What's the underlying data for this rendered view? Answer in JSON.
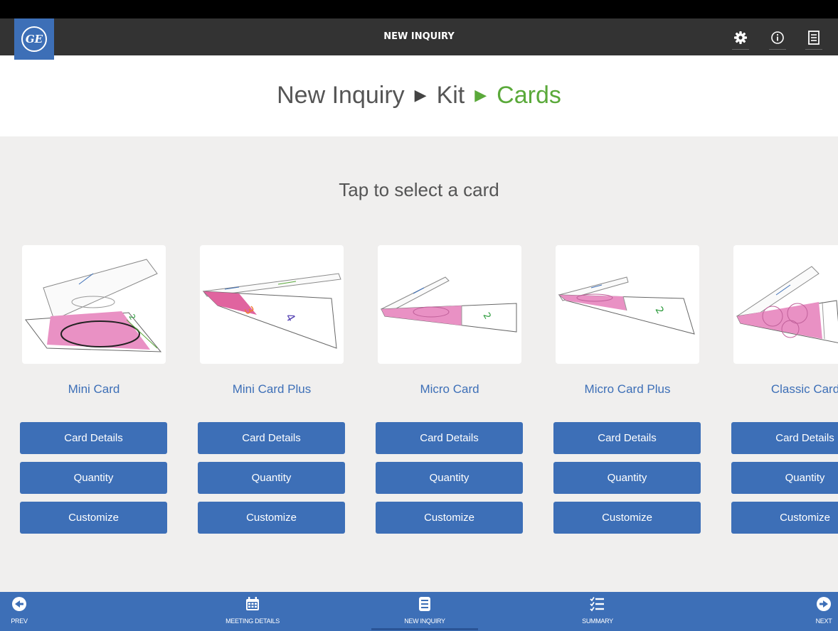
{
  "header": {
    "title": "NEW INQUIRY",
    "logo_text": "GE",
    "icons": [
      "gear-icon",
      "info-icon",
      "list-icon"
    ]
  },
  "breadcrumb": {
    "items": [
      "New Inquiry",
      "Kit",
      "Cards"
    ],
    "separator": "▶",
    "active_index": 2
  },
  "prompt": "Tap to select a card",
  "cards": [
    {
      "name": "Mini Card",
      "details_label": "Card Details",
      "quantity_label": "Quantity",
      "customize_label": "Customize"
    },
    {
      "name": "Mini Card Plus",
      "details_label": "Card Details",
      "quantity_label": "Quantity",
      "customize_label": "Customize"
    },
    {
      "name": "Micro Card",
      "details_label": "Card Details",
      "quantity_label": "Quantity",
      "customize_label": "Customize"
    },
    {
      "name": "Micro Card Plus",
      "details_label": "Card Details",
      "quantity_label": "Quantity",
      "customize_label": "Customize"
    },
    {
      "name": "Classic Card",
      "details_label": "Card Details",
      "quantity_label": "Quantity",
      "customize_label": "Customize"
    }
  ],
  "bottom_nav": {
    "prev": "PREV",
    "meeting_details": "MEETING DETAILS",
    "new_inquiry": "NEW INQUIRY",
    "summary": "SUMMARY",
    "next": "NEXT"
  },
  "colors": {
    "brand_blue": "#3d6fb7",
    "active_green": "#5aa93a",
    "header_bg": "#333333",
    "content_bg": "#f0efee",
    "card_pink": "#e991c4"
  }
}
